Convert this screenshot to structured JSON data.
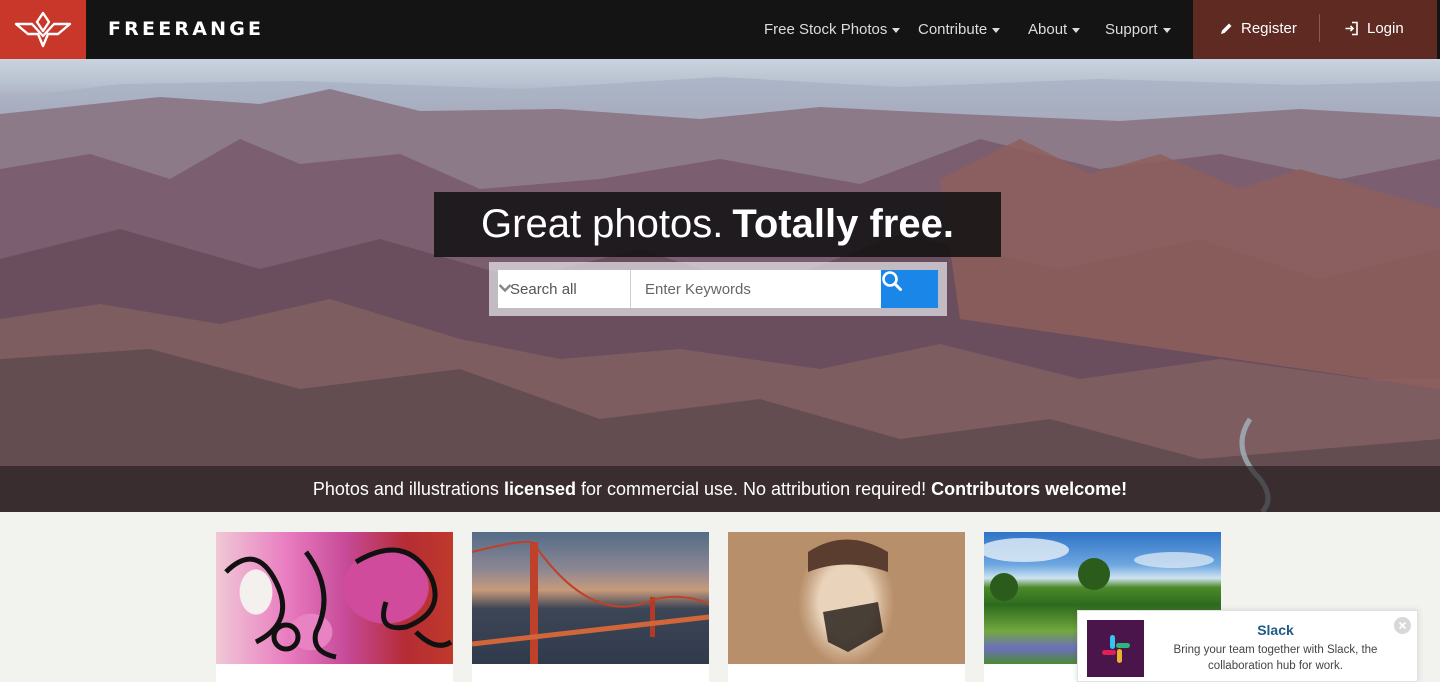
{
  "nav": {
    "brand": "FREERANGE",
    "menu": [
      {
        "label": "Free Stock Photos"
      },
      {
        "label": "Contribute"
      },
      {
        "label": "About"
      },
      {
        "label": "Support"
      }
    ],
    "register": "Register",
    "login": "Login"
  },
  "hero": {
    "headline_light": "Great photos.",
    "headline_bold": "Totally free.",
    "search_scope": "Search all",
    "search_placeholder": "Enter Keywords",
    "tagline": {
      "p1": "Photos and illustrations ",
      "b1": "licensed",
      "p2": " for commercial use. No attribution required! ",
      "b2": "Contributors welcome!"
    }
  },
  "thumbnails": [
    {
      "subject": "graffiti"
    },
    {
      "subject": "golden-gate-bridge"
    },
    {
      "subject": "painted-face"
    },
    {
      "subject": "meadow"
    }
  ],
  "ad": {
    "title": "Slack",
    "text": "Bring your team together with Slack, the collaboration hub for work."
  },
  "colors": {
    "logo_red": "#c8372a",
    "account_bg": "#5e2a22",
    "search_blue": "#1a86e8",
    "navbar_bg": "#141414"
  }
}
